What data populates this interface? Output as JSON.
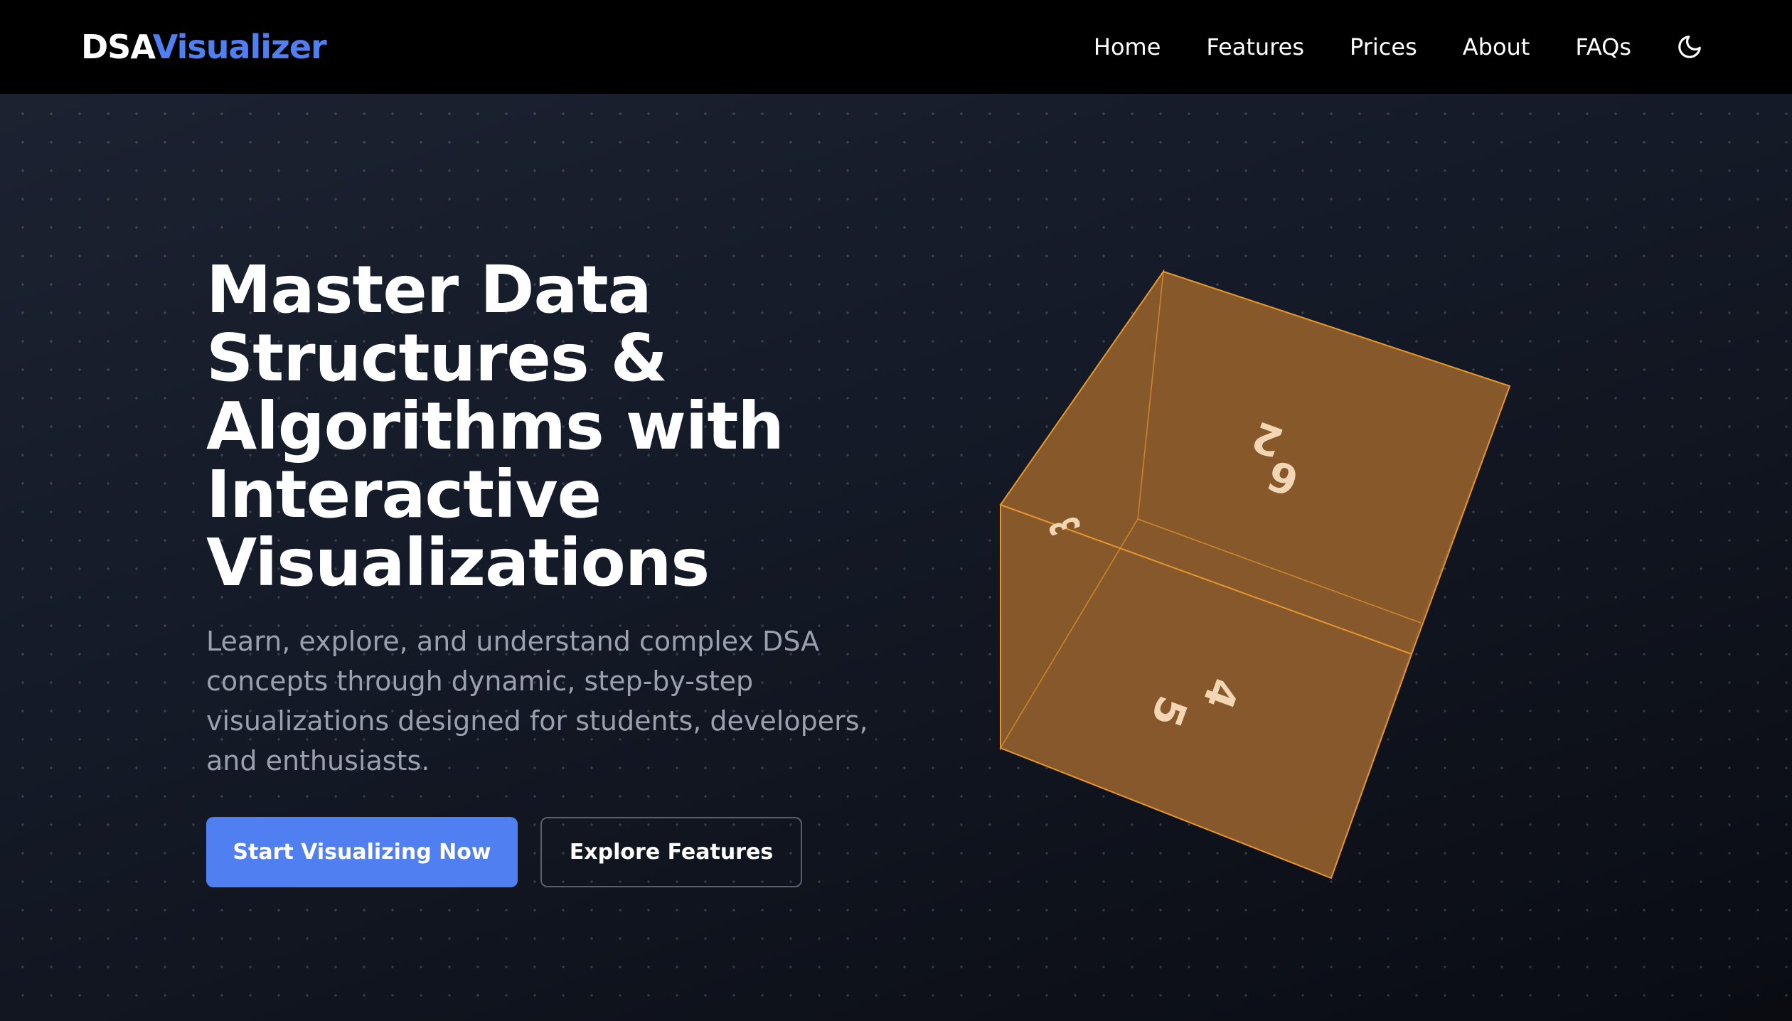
{
  "navbar": {
    "logo": {
      "part1": "DSA",
      "part2": "Visualizer"
    },
    "links": [
      "Home",
      "Features",
      "Prices",
      "About",
      "FAQs"
    ],
    "theme_toggle_icon": "moon-icon"
  },
  "hero": {
    "title": "Master Data Structures & Algorithms with Interactive Visualizations",
    "subtitle": "Learn, explore, and understand complex DSA concepts through dynamic, step-by-step visualizations designed for students, developers, and enthusiasts.",
    "primary_button": "Start Visualizing Now",
    "secondary_button": "Explore Features"
  },
  "cube": {
    "face_labels": [
      "6",
      "2",
      "3",
      "4",
      "5"
    ],
    "color": "#8a5a2b",
    "edge_color": "#e0952e"
  }
}
